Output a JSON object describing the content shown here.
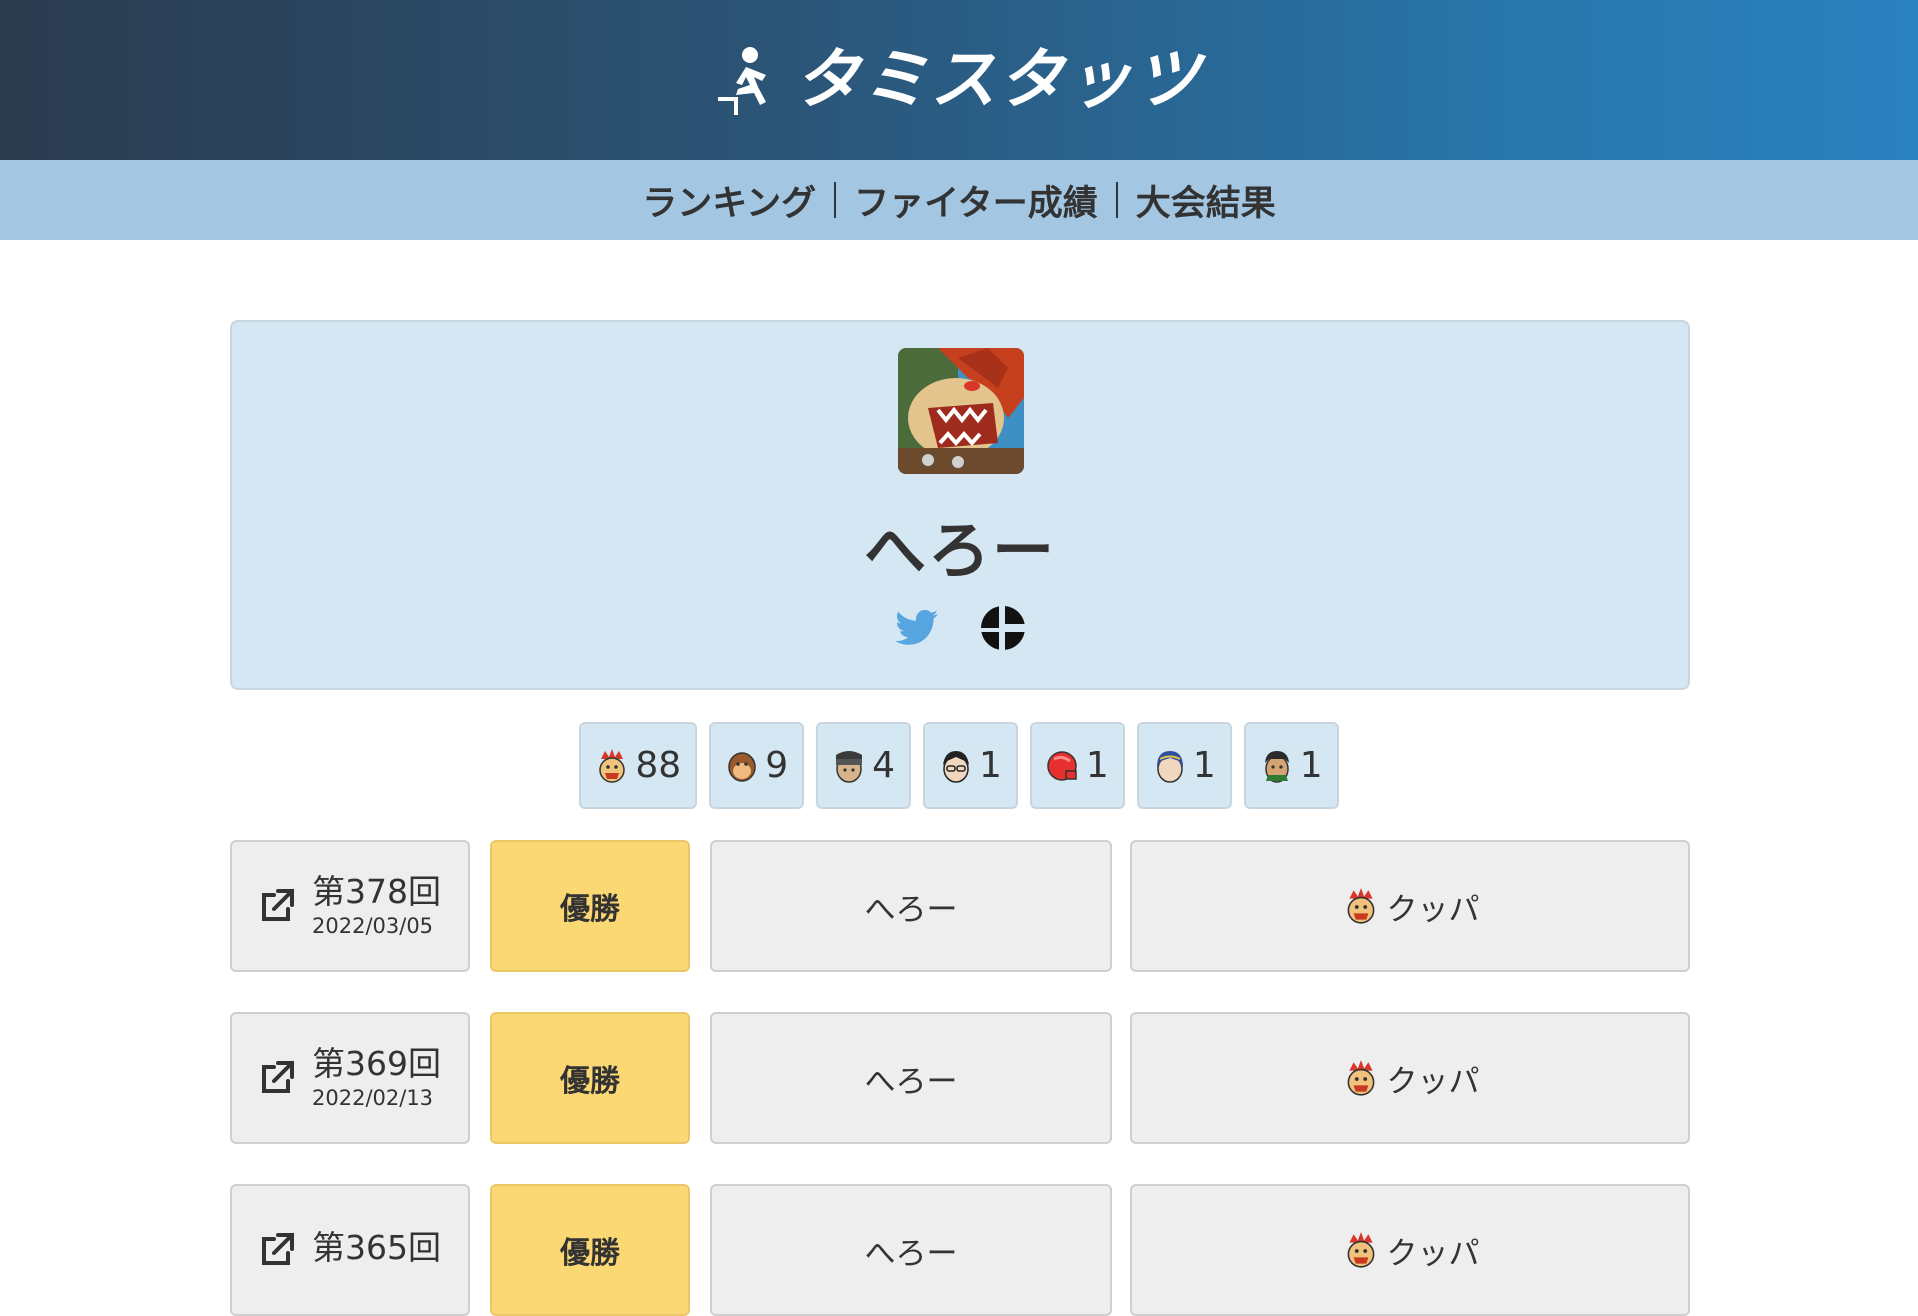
{
  "header": {
    "logo_text": "タミスタッツ"
  },
  "nav": {
    "ranking": "ランキング",
    "fighter_results": "ファイター成績",
    "tournament_results": "大会結果"
  },
  "profile": {
    "name": "へろー",
    "avatar_icon": "bowser-portrait",
    "social": [
      "twitter-icon",
      "smash-icon"
    ]
  },
  "fighter_usage": [
    {
      "icon": "bowser-stock-icon",
      "count": "88"
    },
    {
      "icon": "donkey-kong-stock-icon",
      "count": "9"
    },
    {
      "icon": "snake-stock-icon",
      "count": "4"
    },
    {
      "icon": "bayonetta-stock-icon",
      "count": "1"
    },
    {
      "icon": "little-mac-stock-icon",
      "count": "1"
    },
    {
      "icon": "marth-stock-icon",
      "count": "1"
    },
    {
      "icon": "terry-stock-icon",
      "count": "1"
    }
  ],
  "results": [
    {
      "event": "第378回",
      "date": "2022/03/05",
      "placing": "優勝",
      "player": "へろー",
      "fighter": "クッパ"
    },
    {
      "event": "第369回",
      "date": "2022/02/13",
      "placing": "優勝",
      "player": "へろー",
      "fighter": "クッパ"
    },
    {
      "event": "第365回",
      "date": "",
      "placing": "優勝",
      "player": "へろー",
      "fighter": "クッパ"
    }
  ],
  "colors": {
    "header_start": "#2b3b4e",
    "header_end": "#2a82bf",
    "nav_bg": "#a3c7e3",
    "card_bg": "#d6e7f4",
    "winner_bg": "#fcd874",
    "cell_bg": "#eeeeee"
  }
}
